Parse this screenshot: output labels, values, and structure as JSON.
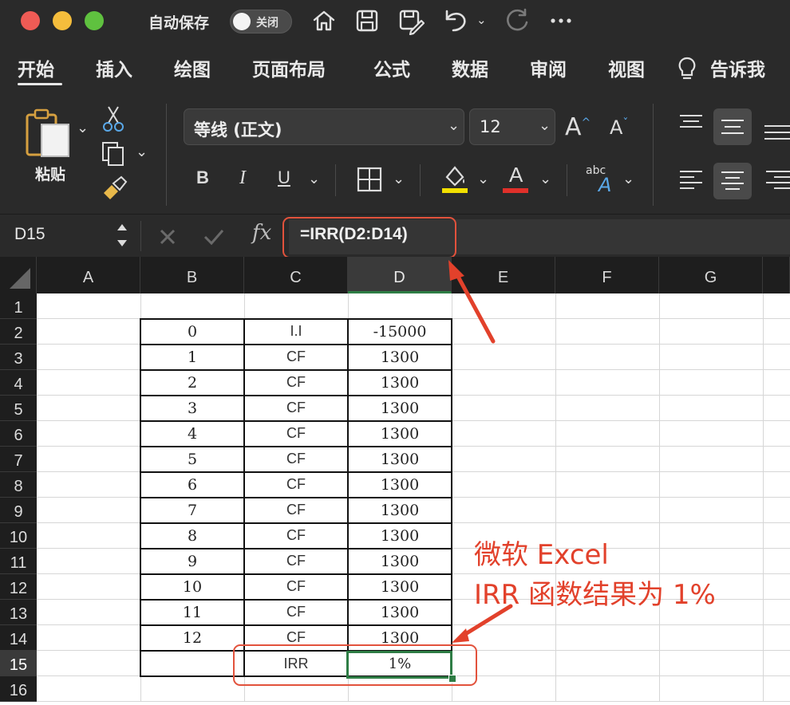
{
  "titlebar": {
    "autosave_label": "自动保存",
    "toggle_label": "关闭"
  },
  "tabs": [
    "开始",
    "插入",
    "绘图",
    "页面布局",
    "公式",
    "数据",
    "审阅",
    "视图"
  ],
  "tell_me": "告诉我",
  "ribbon": {
    "paste_label": "粘贴",
    "font_name": "等线 (正文)",
    "font_size": "12",
    "bold": "B",
    "italic": "I",
    "underline": "U",
    "font_color_glyph": "A",
    "grow_font": "A",
    "shrink_font": "A",
    "wrap_glyph_top": "abc",
    "wrap_glyph_bottom": "A"
  },
  "formula_bar": {
    "name_box": "D15",
    "fx": "fx",
    "formula": "=IRR(D2:D14)"
  },
  "columns": [
    "A",
    "B",
    "C",
    "D",
    "E",
    "F",
    "G"
  ],
  "selected_column": "D",
  "rows": [
    "1",
    "2",
    "3",
    "4",
    "5",
    "6",
    "7",
    "8",
    "9",
    "10",
    "11",
    "12",
    "13",
    "14",
    "15",
    "16"
  ],
  "selected_row": "15",
  "table": [
    {
      "b": "0",
      "c": "I.I",
      "d": "-15000"
    },
    {
      "b": "1",
      "c": "CF",
      "d": "1300"
    },
    {
      "b": "2",
      "c": "CF",
      "d": "1300"
    },
    {
      "b": "3",
      "c": "CF",
      "d": "1300"
    },
    {
      "b": "4",
      "c": "CF",
      "d": "1300"
    },
    {
      "b": "5",
      "c": "CF",
      "d": "1300"
    },
    {
      "b": "6",
      "c": "CF",
      "d": "1300"
    },
    {
      "b": "7",
      "c": "CF",
      "d": "1300"
    },
    {
      "b": "8",
      "c": "CF",
      "d": "1300"
    },
    {
      "b": "9",
      "c": "CF",
      "d": "1300"
    },
    {
      "b": "10",
      "c": "CF",
      "d": "1300"
    },
    {
      "b": "11",
      "c": "CF",
      "d": "1300"
    },
    {
      "b": "12",
      "c": "CF",
      "d": "1300"
    }
  ],
  "result_row": {
    "c": "IRR",
    "d": "1%"
  },
  "annotation": {
    "line1": "微软 Excel",
    "line2": "IRR 函数结果为 1%"
  },
  "colors": {
    "chrome": "#2a2a2a",
    "highlight_red": "#e2412b",
    "selection_green": "#2e7d45",
    "traffic_red": "#ee5b55",
    "traffic_yellow": "#f5bd3c",
    "traffic_green": "#5fc13f"
  }
}
